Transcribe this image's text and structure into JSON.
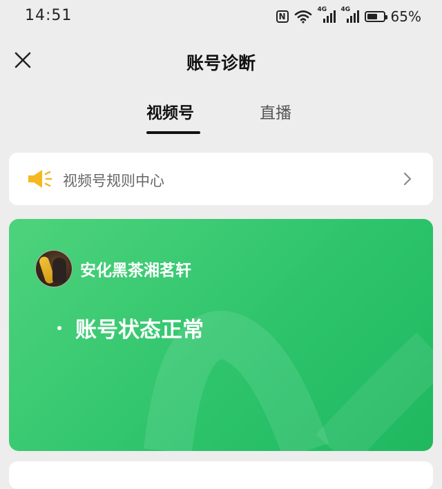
{
  "status_bar": {
    "time": "14:51",
    "signal1_label": "4G",
    "signal2_label": "4G",
    "battery_percent": "65%",
    "battery_level": 0.65,
    "icons": [
      "nfc-icon",
      "wifi-icon",
      "signal-icon",
      "battery-icon"
    ]
  },
  "header": {
    "title": "账号诊断",
    "close_icon": "close-icon"
  },
  "tabs": [
    {
      "label": "视频号",
      "active": true
    },
    {
      "label": "直播",
      "active": false
    }
  ],
  "rules": {
    "label": "视频号规则中心",
    "icon": "speaker-icon",
    "icon_color": "#f5b820"
  },
  "account": {
    "name": "安化黑茶湘茗轩",
    "status": "账号状态正常",
    "card_color": "#2cc36b"
  }
}
